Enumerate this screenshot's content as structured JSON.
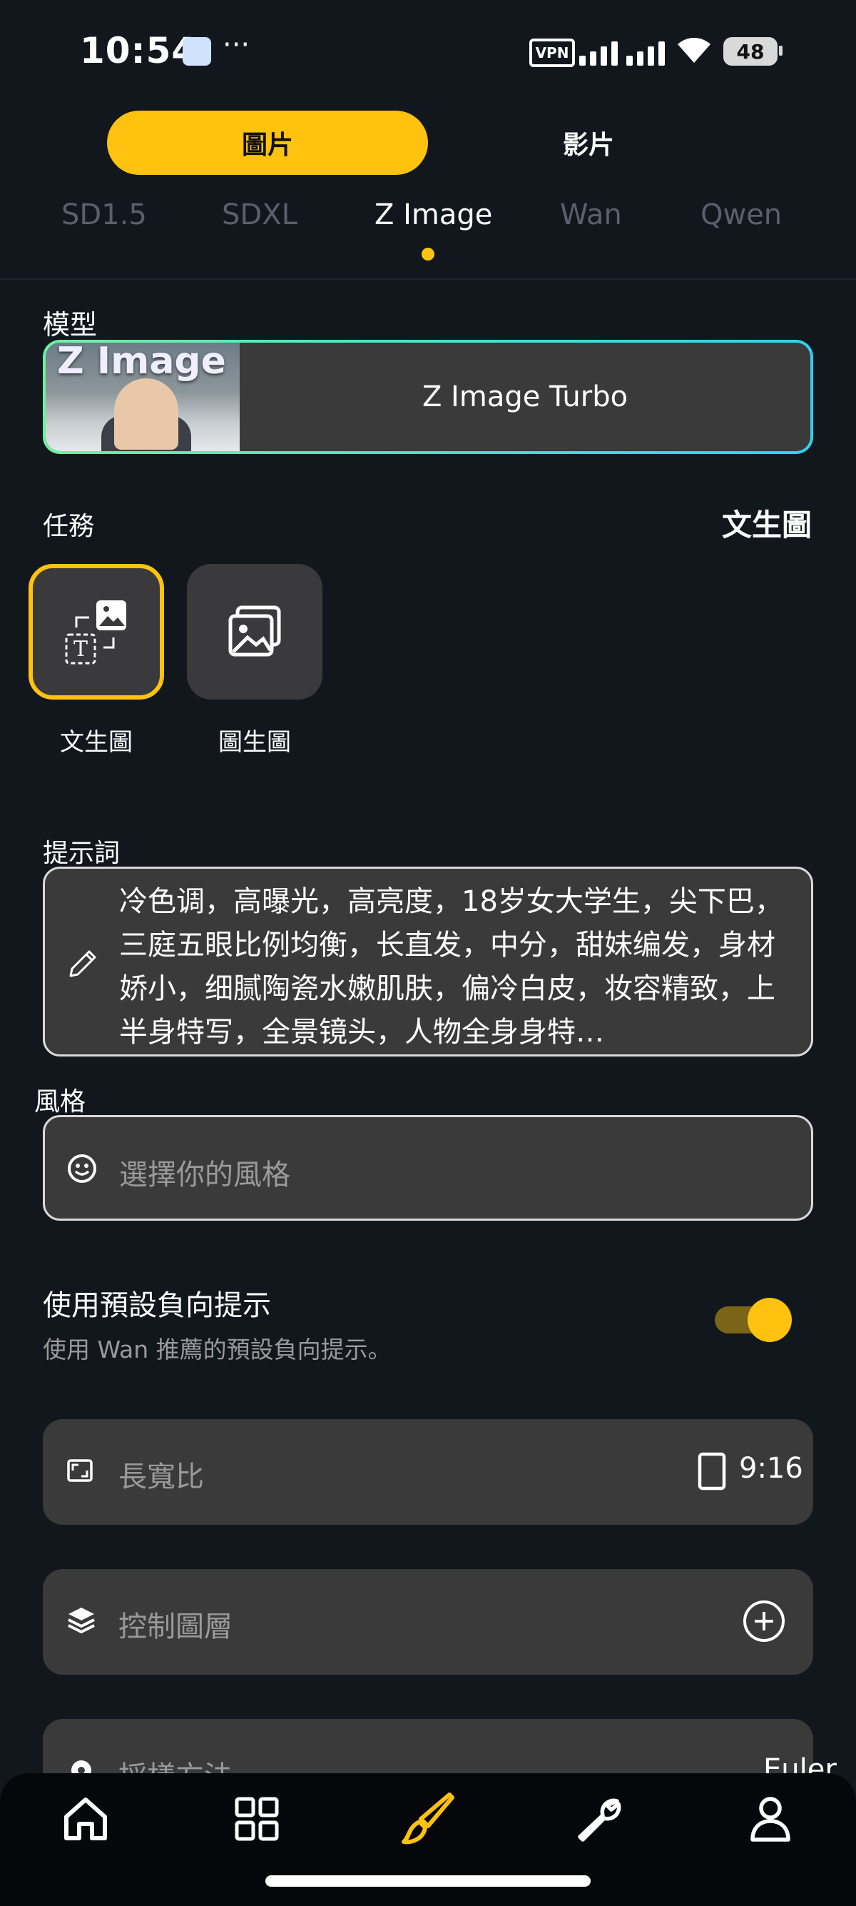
{
  "status_bar": {
    "time": "10:54",
    "dots": "···",
    "vpn": "VPN",
    "battery": "48"
  },
  "media_tabs": [
    {
      "label": "圖片",
      "active": true
    },
    {
      "label": "影片",
      "active": false
    }
  ],
  "model_tabs": [
    {
      "label": "SD1.5",
      "active": false
    },
    {
      "label": "SDXL",
      "active": false
    },
    {
      "label": "Z Image",
      "active": true
    },
    {
      "label": "Wan",
      "active": false
    },
    {
      "label": "Qwen",
      "active": false
    }
  ],
  "model": {
    "section_label": "模型",
    "thumb_text": "Z Image",
    "name": "Z Image Turbo"
  },
  "task": {
    "section_label": "任務",
    "current": "文生圖",
    "options": [
      {
        "label": "文生圖",
        "selected": true
      },
      {
        "label": "圖生圖",
        "selected": false
      }
    ]
  },
  "prompt": {
    "section_label": "提示詞",
    "value": "冷色调，高曝光，高亮度，18岁女大学生，尖下巴，三庭五眼比例均衡，长直发，中分，甜妹编发，身材娇小，细腻陶瓷水嫩肌肤，偏冷白皮，妆容精致，上半身特写，全景镜头，人物全身身特…"
  },
  "style": {
    "section_label": "風格",
    "placeholder": "選擇你的風格"
  },
  "negative_prompt": {
    "title": "使用預設負向提示",
    "subtitle": "使用 Wan 推薦的預設負向提示。",
    "enabled": true
  },
  "aspect_ratio": {
    "label": "長寬比",
    "value": "9:16"
  },
  "control_layer": {
    "label": "控制圖層"
  },
  "sampler": {
    "label": "採樣方法",
    "value": "Euler"
  },
  "bottom_nav": [
    {
      "name": "home",
      "active": false
    },
    {
      "name": "apps",
      "active": false
    },
    {
      "name": "create",
      "active": true
    },
    {
      "name": "tools",
      "active": false
    },
    {
      "name": "profile",
      "active": false
    }
  ],
  "colors": {
    "accent": "#ffc20e",
    "background": "#12161d",
    "card": "#3a3a3b"
  }
}
